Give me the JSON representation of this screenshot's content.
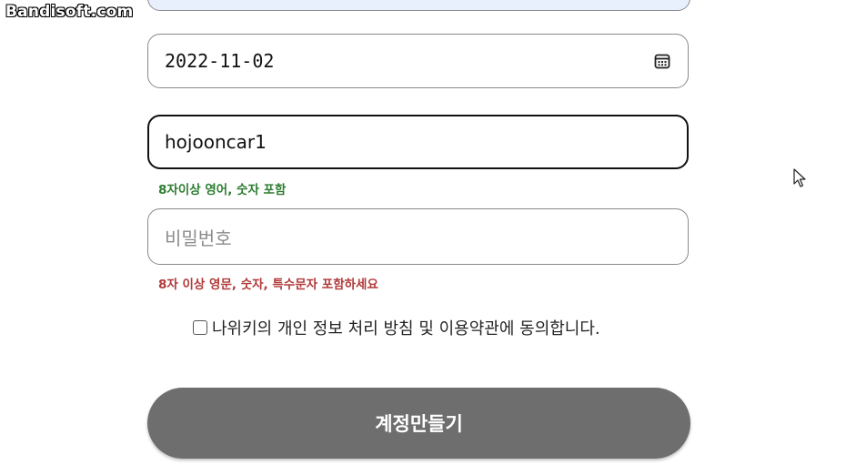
{
  "watermark": "Bandisoft.com",
  "form": {
    "birthdate_value": "2022-11-02",
    "calendar_icon": "calendar-icon",
    "userid_value": "hojooncar1",
    "userid_hint": "8자이상 영어, 숫자 포함",
    "password_placeholder": "비밀번호",
    "password_hint": "8자 이상 영문, 숫자, 특수문자 포함하세요",
    "agree_label": "나위키의 개인 정보 처리 방침 및 이용약관에 동의합니다.",
    "submit_label": "계정만들기"
  },
  "colors": {
    "hint_ok": "#2e7d32",
    "hint_error": "#b23a3a",
    "submit_bg": "#6e6e6e",
    "focused_border": "#111111"
  }
}
